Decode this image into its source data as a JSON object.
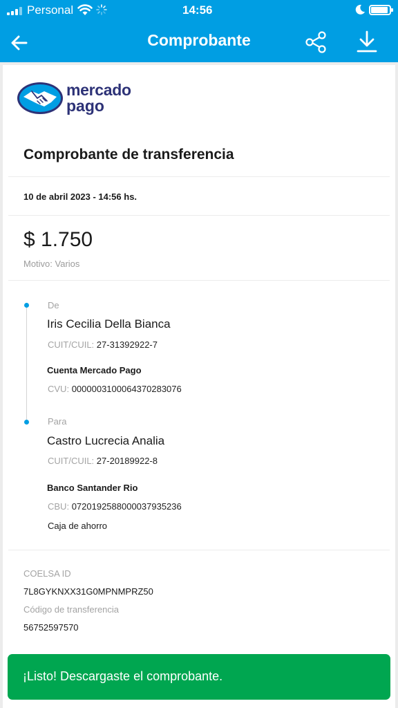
{
  "status_bar": {
    "carrier": "Personal",
    "time": "14:56"
  },
  "header": {
    "title": "Comprobante"
  },
  "brand": {
    "line1": "mercado",
    "line2": "pago"
  },
  "receipt": {
    "title": "Comprobante de transferencia",
    "date": "10 de abril 2023 - 14:56 hs.",
    "amount": "$ 1.750",
    "motivo": "Motivo: Varios"
  },
  "from": {
    "label": "De",
    "name": "Iris Cecilia Della Bianca",
    "cuit_label": "CUIT/CUIL:",
    "cuit": "27-31392922-7",
    "account_type": "Cuenta Mercado Pago",
    "cvu_label": "CVU:",
    "cvu": "0000003100064370283076"
  },
  "to": {
    "label": "Para",
    "name": "Castro Lucrecia Analia",
    "cuit_label": "CUIT/CUIL:",
    "cuit": "27-20189922-8",
    "bank": "Banco Santander Rio",
    "cbu_label": "CBU:",
    "cbu": "0720192588000037935236",
    "account_type": "Caja de ahorro"
  },
  "meta": {
    "coelsa_label": "COELSA ID",
    "coelsa_id": "7L8GYKNXX31G0MPNMPRZ50",
    "code_label": "Código de transferencia",
    "code": "56752597570"
  },
  "toast": {
    "message": "¡Listo! Descargaste el comprobante."
  },
  "colors": {
    "header_bg": "#009ee3",
    "toast_bg": "#00a650",
    "brand_text": "#2d3277"
  }
}
